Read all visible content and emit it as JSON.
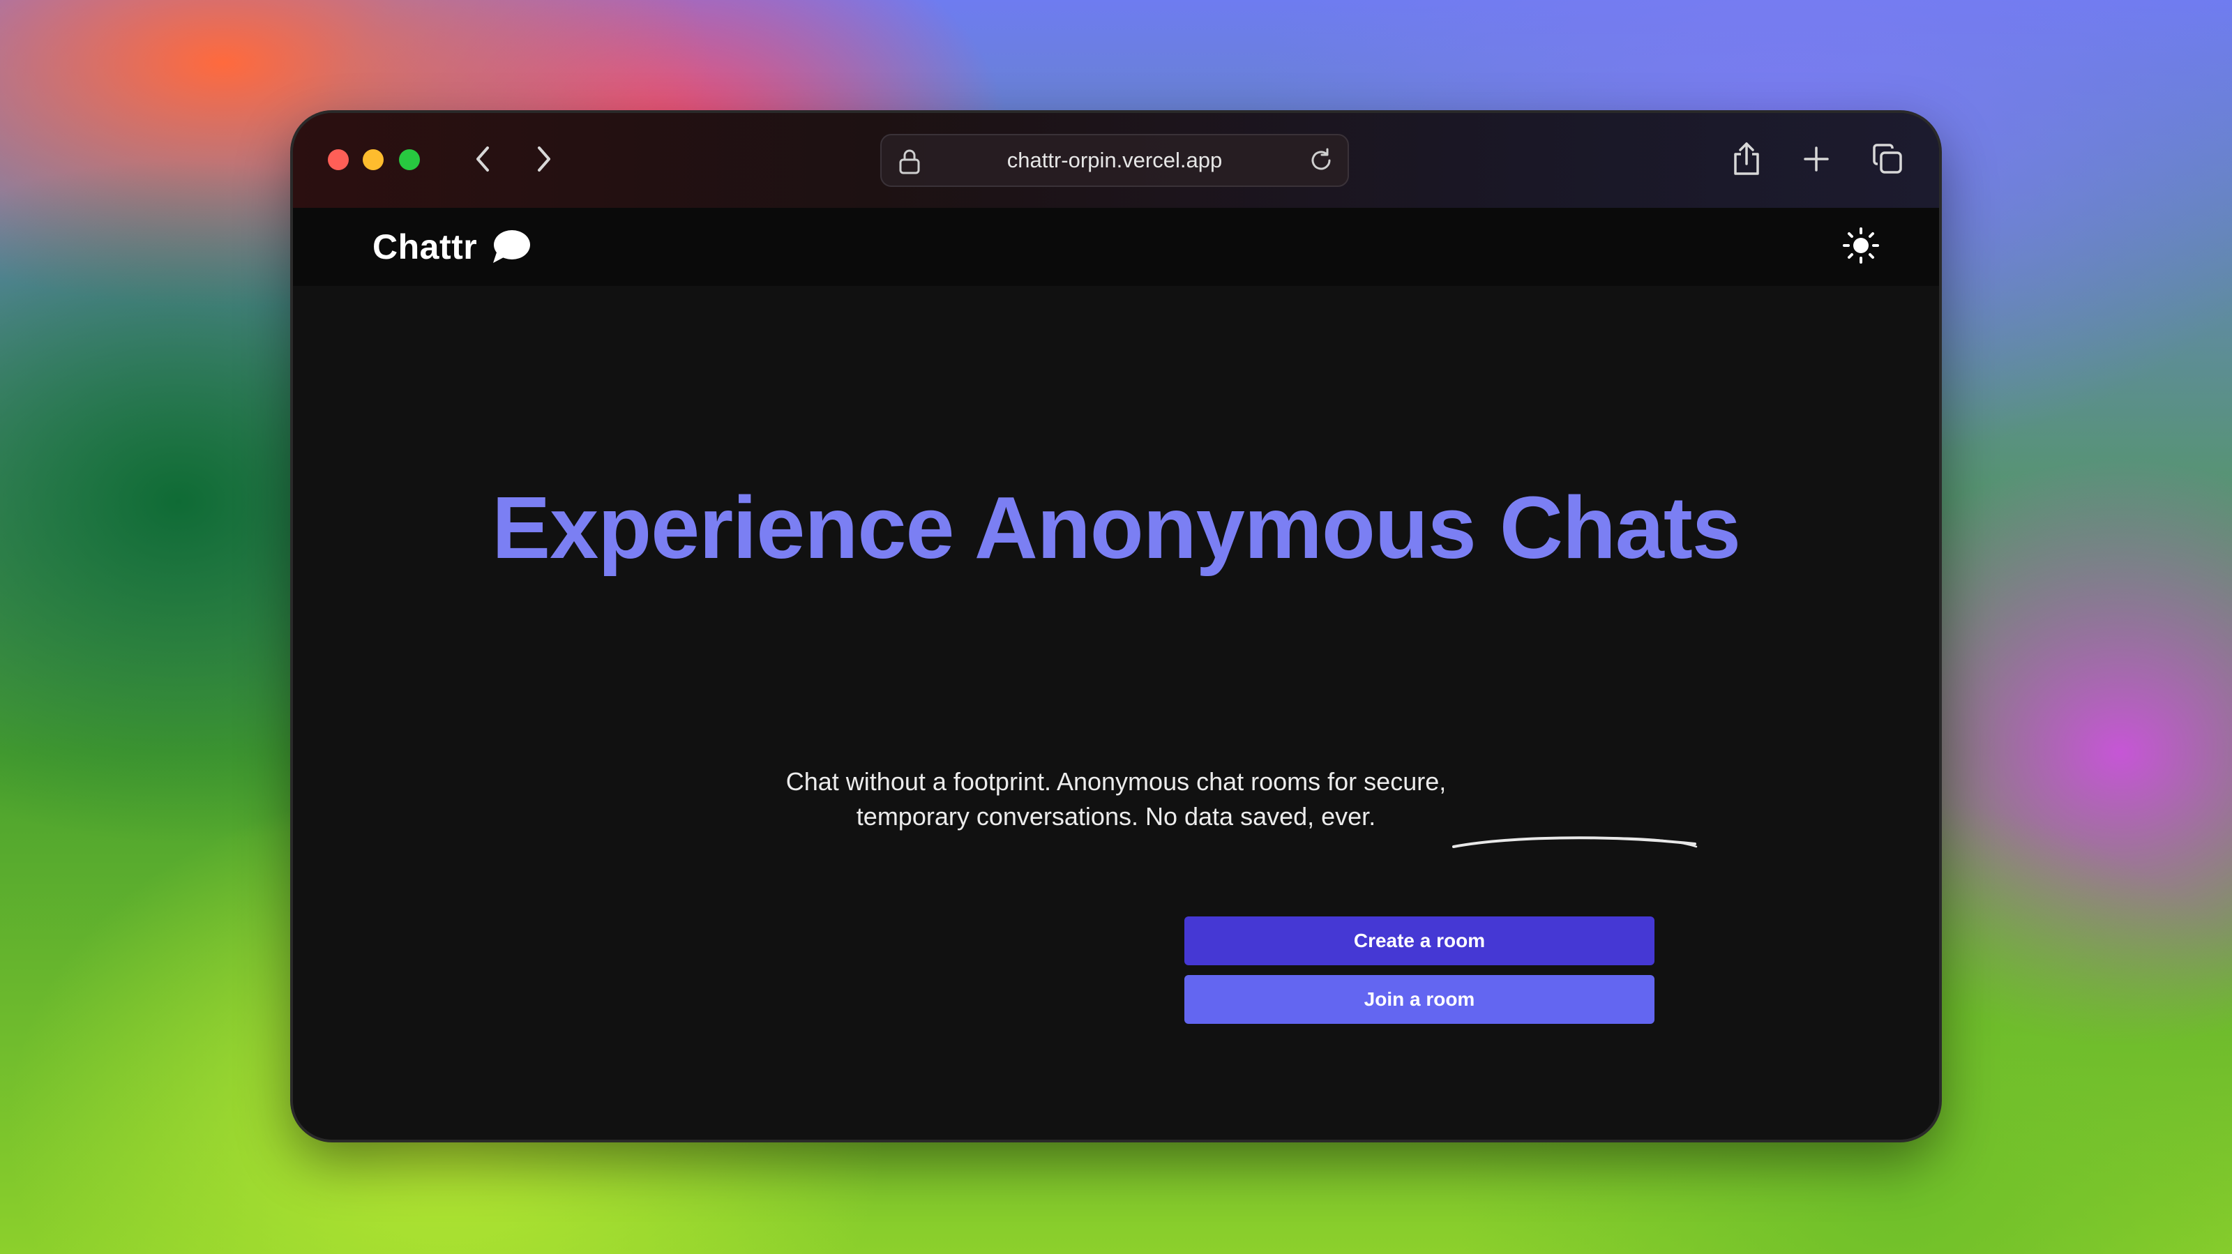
{
  "browser": {
    "url": "chattr-orpin.vercel.app",
    "icons": {
      "back": "chevron-left-icon",
      "forward": "chevron-right-icon",
      "lock": "lock-icon",
      "reload": "reload-icon",
      "share": "share-icon",
      "new_tab": "plus-icon",
      "tabs": "tabs-overview-icon"
    }
  },
  "app": {
    "brand_name": "Chattr",
    "brand_icon": "chat-bubble-icon",
    "theme_toggle_icon": "sun-icon"
  },
  "hero": {
    "title": "Experience Anonymous Chats",
    "subtitle_line1": "Chat without a footprint. Anonymous chat rooms for secure,",
    "subtitle_line2_plain": "temporary conversations. ",
    "subtitle_line2_emphasis": "No data saved, ever."
  },
  "actions": {
    "create_label": "Create a room",
    "join_label": "Join a room"
  },
  "colors": {
    "accent": "#7b7ff3",
    "create_button": "#4538d4",
    "join_button": "#6366f1",
    "background": "#111111"
  }
}
